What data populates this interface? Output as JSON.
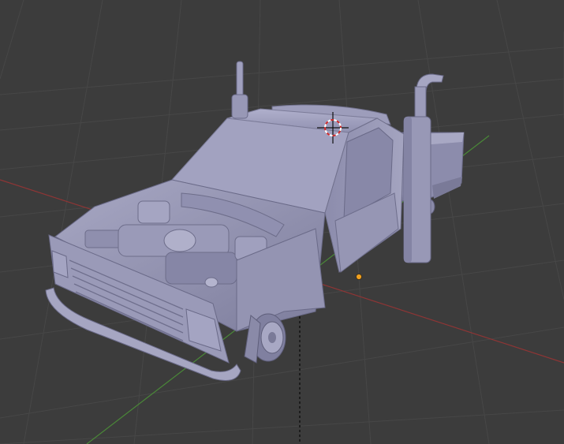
{
  "viewport": {
    "background": "#3c3c3c",
    "grid_color": "#484848",
    "x_axis_color": "#9b3a3a",
    "y_axis_color": "#4d8a3a",
    "model_color": "#9a9ab8",
    "model_shadow": "#6e6e8a",
    "model_highlight": "#b8b8d2",
    "cursor_ring_colors": [
      "#d22a2a",
      "#ffffff"
    ],
    "origin_color": "#f0a020"
  },
  "objects": {
    "model": {
      "icon": "pickup-truck-mesh"
    },
    "cursor": {
      "icon": "3d-cursor-icon"
    },
    "origin": {
      "icon": "object-origin-dot"
    }
  }
}
